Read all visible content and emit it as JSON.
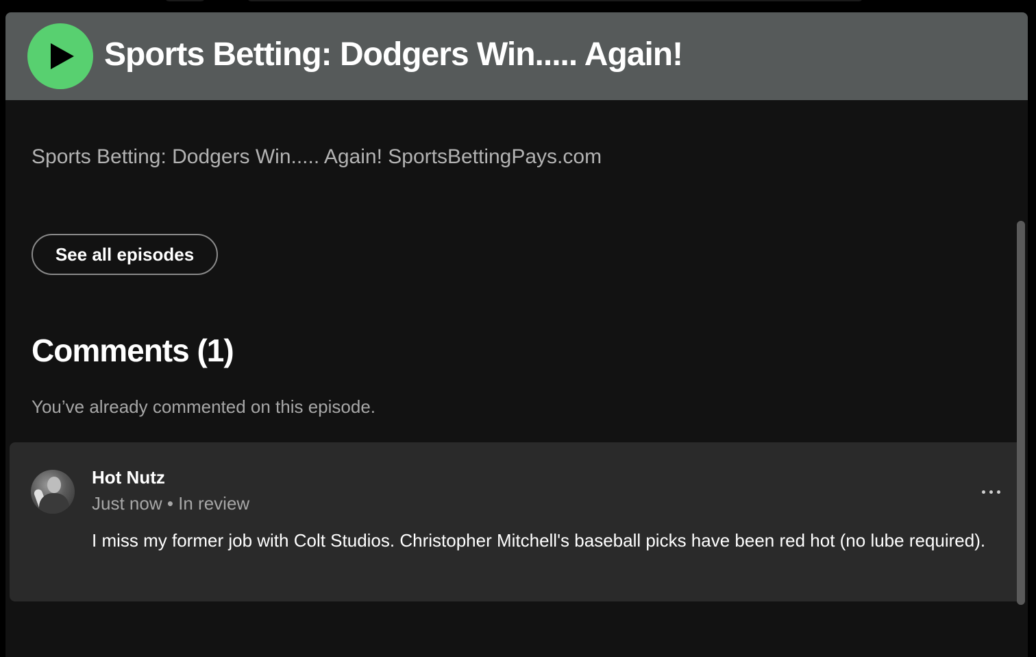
{
  "header": {
    "title": "Sports Betting: Dodgers Win..... Again!"
  },
  "episode": {
    "description": "Sports Betting: Dodgers Win..... Again! SportsBettingPays.com",
    "see_all_label": "See all episodes"
  },
  "comments": {
    "heading": "Comments (1)",
    "notice": "You’ve already commented on this episode.",
    "items": [
      {
        "author": "Hot Nutz",
        "meta": "Just now • In review",
        "text": "I miss my former job with Colt Studios. Christopher Mitchell's baseball picks have been red hot (no lube required)."
      }
    ]
  },
  "colors": {
    "accent": "#58d070",
    "header_bg": "#565a5a",
    "page_bg": "#121212",
    "card_bg": "#2a2a2a"
  },
  "icons": {
    "play": "play-icon",
    "more": "more-options-icon"
  }
}
